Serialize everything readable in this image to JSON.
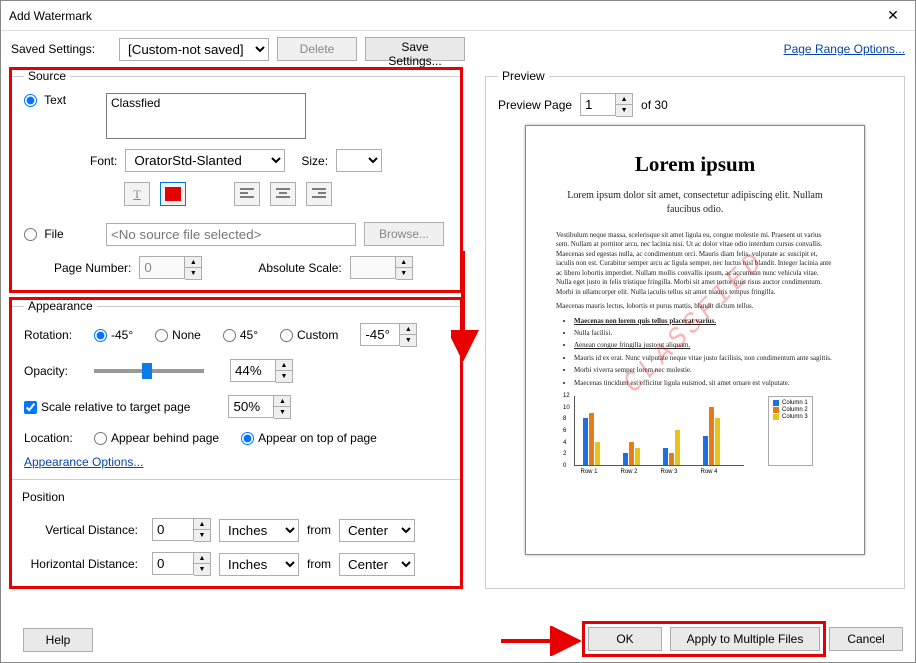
{
  "window": {
    "title": "Add Watermark"
  },
  "toolbar": {
    "saved_label": "Saved Settings:",
    "saved_value": "[Custom-not saved]",
    "delete": "Delete",
    "save_as": "Save Settings...",
    "page_range": "Page Range Options..."
  },
  "source": {
    "legend": "Source",
    "text_radio": "Text",
    "text_value": "Classfied",
    "font_label": "Font:",
    "font_value": "OratorStd-Slanted",
    "size_label": "Size:",
    "size_value": "",
    "file_radio": "File",
    "file_value": "<No source file selected>",
    "browse": "Browse...",
    "pagenum_label": "Page Number:",
    "pagenum_value": "0",
    "abs_scale_label": "Absolute Scale:",
    "abs_scale_value": ""
  },
  "appearance": {
    "legend": "Appearance",
    "rotation_label": "Rotation:",
    "rot_m45": "-45°",
    "rot_none": "None",
    "rot_45": "45°",
    "rot_custom": "Custom",
    "rot_value": "-45°",
    "opacity_label": "Opacity:",
    "opacity_value": "44%",
    "scale_rel_label": "Scale relative to target page",
    "scale_rel_value": "50%",
    "location_label": "Location:",
    "loc_behind": "Appear behind page",
    "loc_top": "Appear on top of page",
    "options_link": "Appearance Options..."
  },
  "position": {
    "legend": "Position",
    "vdist_label": "Vertical Distance:",
    "hdist_label": "Horizontal Distance:",
    "value": "0",
    "unit": "Inches",
    "from_label": "from",
    "from_value": "Center"
  },
  "preview": {
    "legend": "Preview",
    "page_label": "Preview Page",
    "page_value": "1",
    "page_total": "of 30",
    "doc": {
      "title": "Lorem ipsum",
      "subtitle": "Lorem ipsum dolor sit amet, consectetur adipiscing elit. Nullam faucibus odio.",
      "para1": "Vestibulum neque massa, scelerisque sit amet ligula eu, congue molestie mi. Praesent ut varius sem. Nullam at porttitor arcu, nec lacinia nisi. Ut ac dolor vitae odio interdum cursus convallis. Maecenas sed egestas nulla, ac condimentum orci. Mauris diam felis, vulputate ac suscipit et, iaculis non est. Curabitur semper arcu ac ligula semper, nec luctus nisl blandit. Integer lacinia ante ac libero lobortis imperdiet. Nullam mollis convallis ipsum, ac accumsan nunc vehicula vitae. Nulla eget justo in felis tristique fringilla. Morbi sit amet tortor quis risus auctor condimentum. Morbi in ullamcorper elit. Nulla iaculis tellus sit amet mauris tempus fringilla.",
      "para2": "Maecenas mauris lectus, lobortis et purus mattis, blandit dictum tellus.",
      "b1": "Maecenas non lorem quis tellus placerat varius.",
      "b2": "Nulla facilisi.",
      "b3": "Aenean congue fringilla justo ut aliquam.",
      "b4": "Mauris id ex erat. Nunc vulputate neque vitae justo facilisis, non condimentum ante sagittis.",
      "b5": "Morbi viverra semper lorem nec molestie.",
      "b6": "Maecenas tincidunt est efficitur ligula euismod, sit amet ornare est vulputate.",
      "watermark": "CLASSFIED"
    }
  },
  "footer": {
    "help": "Help",
    "ok": "OK",
    "apply_multi": "Apply to Multiple Files",
    "cancel": "Cancel"
  },
  "chart_data": {
    "type": "bar",
    "categories": [
      "Row 1",
      "Row 2",
      "Row 3",
      "Row 4"
    ],
    "series": [
      {
        "name": "Column 1",
        "color": "#1f6fe0",
        "values": [
          8,
          2,
          3,
          5
        ]
      },
      {
        "name": "Column 2",
        "color": "#e67b1a",
        "values": [
          9,
          4,
          2,
          10
        ]
      },
      {
        "name": "Column 3",
        "color": "#e8c41a",
        "values": [
          4,
          3,
          6,
          8
        ]
      }
    ],
    "ylim": [
      0,
      12
    ],
    "yticks": [
      0,
      2,
      4,
      6,
      8,
      10,
      12
    ]
  }
}
